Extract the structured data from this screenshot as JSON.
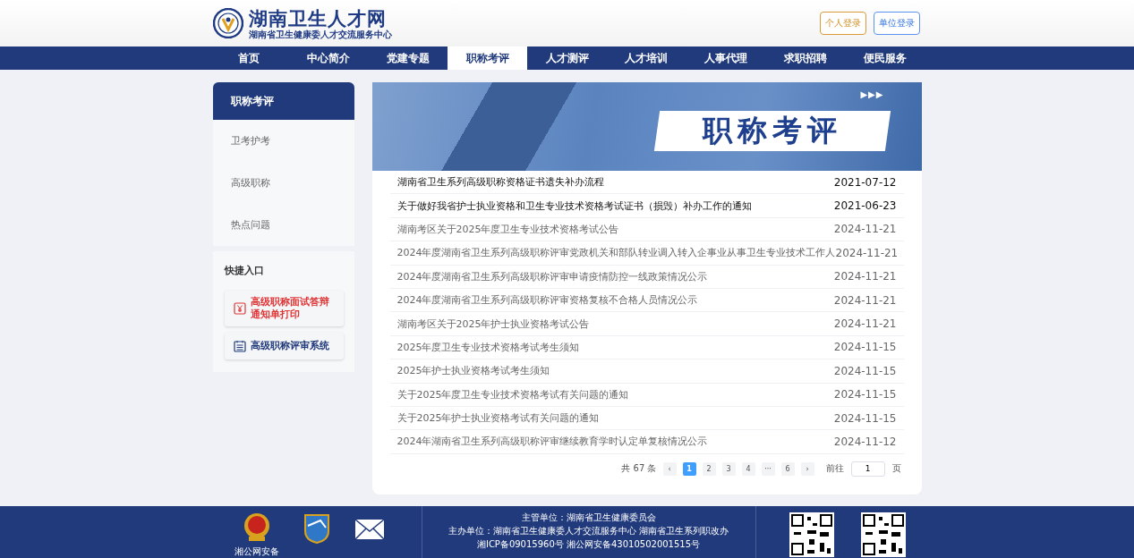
{
  "header": {
    "site_title": "湖南卫生人才网",
    "site_subtitle": "湖南省卫生健康委人才交流服务中心",
    "logins": [
      {
        "label": "个人登录",
        "kind": "personal"
      },
      {
        "label": "单位登录",
        "kind": "unit"
      }
    ]
  },
  "nav": [
    {
      "label": "首页",
      "selected": false
    },
    {
      "label": "中心简介",
      "selected": false
    },
    {
      "label": "党建专题",
      "selected": false
    },
    {
      "label": "职称考评",
      "selected": true
    },
    {
      "label": "人才测评",
      "selected": false
    },
    {
      "label": "人才培训",
      "selected": false
    },
    {
      "label": "人事代理",
      "selected": false
    },
    {
      "label": "求职招聘",
      "selected": false
    },
    {
      "label": "便民服务",
      "selected": false
    }
  ],
  "sidebar": {
    "title": "职称考评",
    "items": [
      {
        "label": "卫考护考"
      },
      {
        "label": "高级职称"
      },
      {
        "label": "热点问题"
      }
    ],
    "quick_title": "快捷入口",
    "quick_links": [
      {
        "label": "高级职称面试答辩通知单打印",
        "kind": "print"
      },
      {
        "label": "高级职称评审系统",
        "kind": "system"
      }
    ]
  },
  "banner": {
    "title": "职称考评",
    "arrows": "▶▶▶"
  },
  "articles": [
    {
      "title": "湖南省卫生系列高级职称资格证书遗失补办流程",
      "date": "2021-07-12",
      "pinned": true
    },
    {
      "title": "关于做好我省护士执业资格和卫生专业技术资格考试证书（损毁）补办工作的通知",
      "date": "2021-06-23",
      "pinned": true
    },
    {
      "title": "湖南考区关于2025年度卫生专业技术资格考试公告",
      "date": "2024-11-21",
      "pinned": false
    },
    {
      "title": "2024年度湖南省卫生系列高级职称评审党政机关和部队转业调入转入企事业从事卫生专业技术工作人",
      "date": "2024-11-21",
      "pinned": false
    },
    {
      "title": "2024年度湖南省卫生系列高级职称评审申请疫情防控一线政策情况公示",
      "date": "2024-11-21",
      "pinned": false
    },
    {
      "title": "2024年度湖南省卫生系列高级职称评审资格复核不合格人员情况公示",
      "date": "2024-11-21",
      "pinned": false
    },
    {
      "title": "湖南考区关于2025年护士执业资格考试公告",
      "date": "2024-11-21",
      "pinned": false
    },
    {
      "title": "2025年度卫生专业技术资格考试考生须知",
      "date": "2024-11-15",
      "pinned": false
    },
    {
      "title": "2025年护士执业资格考试考生须知",
      "date": "2024-11-15",
      "pinned": false
    },
    {
      "title": "关于2025年度卫生专业技术资格考试有关问题的通知",
      "date": "2024-11-15",
      "pinned": false
    },
    {
      "title": "关于2025年护士执业资格考试有关问题的通知",
      "date": "2024-11-15",
      "pinned": false
    },
    {
      "title": "2024年湖南省卫生系列高级职称评审继续教育学时认定单复核情况公示",
      "date": "2024-11-12",
      "pinned": false
    }
  ],
  "pagination": {
    "total": "共 67 条",
    "prev": "‹",
    "next": "›",
    "pages": [
      {
        "label": "1",
        "selected": true
      },
      {
        "label": "2",
        "selected": false
      },
      {
        "label": "3",
        "selected": false
      },
      {
        "label": "4",
        "selected": false
      },
      {
        "label": "···",
        "selected": false
      },
      {
        "label": "6",
        "selected": false
      }
    ],
    "goto_label": "前往",
    "goto_value": "1",
    "goto_unit": "页"
  },
  "footer": {
    "police_label": "湘公网安备",
    "lines": [
      "主管单位：湖南省卫生健康委员会",
      "主办单位：湖南省卫生健康委人才交流服务中心 湖南省卫生系列职改办",
      "湘ICP备09015960号 湘公网安备43010502001515号"
    ]
  }
}
